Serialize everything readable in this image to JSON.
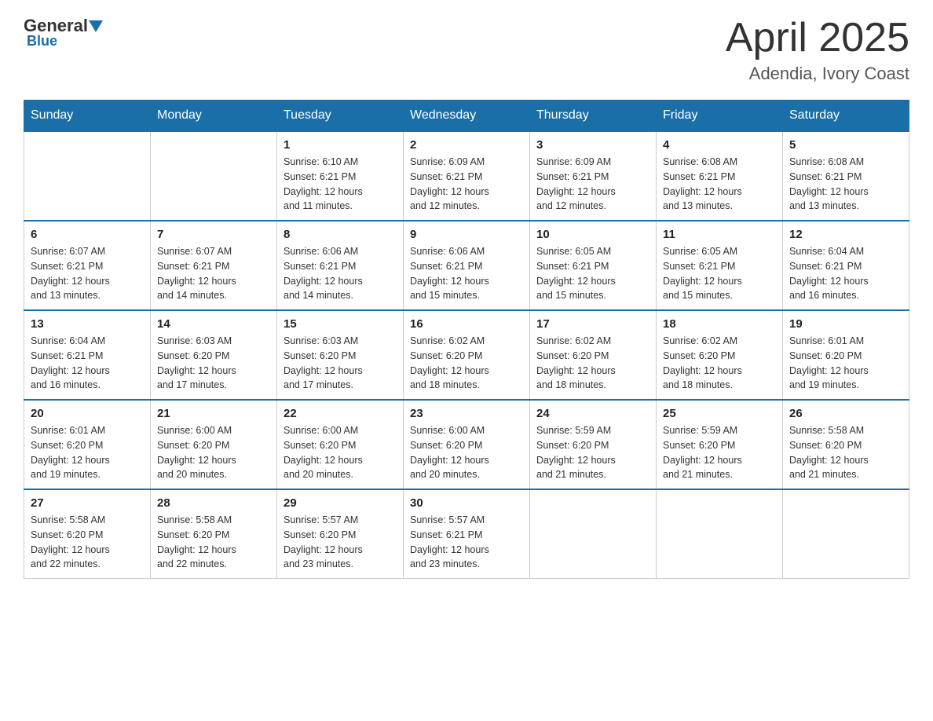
{
  "logo": {
    "general": "General",
    "triangle": "▶",
    "blue": "Blue"
  },
  "header": {
    "month": "April 2025",
    "location": "Adendia, Ivory Coast"
  },
  "weekdays": [
    "Sunday",
    "Monday",
    "Tuesday",
    "Wednesday",
    "Thursday",
    "Friday",
    "Saturday"
  ],
  "weeks": [
    [
      {
        "day": "",
        "info": ""
      },
      {
        "day": "",
        "info": ""
      },
      {
        "day": "1",
        "info": "Sunrise: 6:10 AM\nSunset: 6:21 PM\nDaylight: 12 hours\nand 11 minutes."
      },
      {
        "day": "2",
        "info": "Sunrise: 6:09 AM\nSunset: 6:21 PM\nDaylight: 12 hours\nand 12 minutes."
      },
      {
        "day": "3",
        "info": "Sunrise: 6:09 AM\nSunset: 6:21 PM\nDaylight: 12 hours\nand 12 minutes."
      },
      {
        "day": "4",
        "info": "Sunrise: 6:08 AM\nSunset: 6:21 PM\nDaylight: 12 hours\nand 13 minutes."
      },
      {
        "day": "5",
        "info": "Sunrise: 6:08 AM\nSunset: 6:21 PM\nDaylight: 12 hours\nand 13 minutes."
      }
    ],
    [
      {
        "day": "6",
        "info": "Sunrise: 6:07 AM\nSunset: 6:21 PM\nDaylight: 12 hours\nand 13 minutes."
      },
      {
        "day": "7",
        "info": "Sunrise: 6:07 AM\nSunset: 6:21 PM\nDaylight: 12 hours\nand 14 minutes."
      },
      {
        "day": "8",
        "info": "Sunrise: 6:06 AM\nSunset: 6:21 PM\nDaylight: 12 hours\nand 14 minutes."
      },
      {
        "day": "9",
        "info": "Sunrise: 6:06 AM\nSunset: 6:21 PM\nDaylight: 12 hours\nand 15 minutes."
      },
      {
        "day": "10",
        "info": "Sunrise: 6:05 AM\nSunset: 6:21 PM\nDaylight: 12 hours\nand 15 minutes."
      },
      {
        "day": "11",
        "info": "Sunrise: 6:05 AM\nSunset: 6:21 PM\nDaylight: 12 hours\nand 15 minutes."
      },
      {
        "day": "12",
        "info": "Sunrise: 6:04 AM\nSunset: 6:21 PM\nDaylight: 12 hours\nand 16 minutes."
      }
    ],
    [
      {
        "day": "13",
        "info": "Sunrise: 6:04 AM\nSunset: 6:21 PM\nDaylight: 12 hours\nand 16 minutes."
      },
      {
        "day": "14",
        "info": "Sunrise: 6:03 AM\nSunset: 6:20 PM\nDaylight: 12 hours\nand 17 minutes."
      },
      {
        "day": "15",
        "info": "Sunrise: 6:03 AM\nSunset: 6:20 PM\nDaylight: 12 hours\nand 17 minutes."
      },
      {
        "day": "16",
        "info": "Sunrise: 6:02 AM\nSunset: 6:20 PM\nDaylight: 12 hours\nand 18 minutes."
      },
      {
        "day": "17",
        "info": "Sunrise: 6:02 AM\nSunset: 6:20 PM\nDaylight: 12 hours\nand 18 minutes."
      },
      {
        "day": "18",
        "info": "Sunrise: 6:02 AM\nSunset: 6:20 PM\nDaylight: 12 hours\nand 18 minutes."
      },
      {
        "day": "19",
        "info": "Sunrise: 6:01 AM\nSunset: 6:20 PM\nDaylight: 12 hours\nand 19 minutes."
      }
    ],
    [
      {
        "day": "20",
        "info": "Sunrise: 6:01 AM\nSunset: 6:20 PM\nDaylight: 12 hours\nand 19 minutes."
      },
      {
        "day": "21",
        "info": "Sunrise: 6:00 AM\nSunset: 6:20 PM\nDaylight: 12 hours\nand 20 minutes."
      },
      {
        "day": "22",
        "info": "Sunrise: 6:00 AM\nSunset: 6:20 PM\nDaylight: 12 hours\nand 20 minutes."
      },
      {
        "day": "23",
        "info": "Sunrise: 6:00 AM\nSunset: 6:20 PM\nDaylight: 12 hours\nand 20 minutes."
      },
      {
        "day": "24",
        "info": "Sunrise: 5:59 AM\nSunset: 6:20 PM\nDaylight: 12 hours\nand 21 minutes."
      },
      {
        "day": "25",
        "info": "Sunrise: 5:59 AM\nSunset: 6:20 PM\nDaylight: 12 hours\nand 21 minutes."
      },
      {
        "day": "26",
        "info": "Sunrise: 5:58 AM\nSunset: 6:20 PM\nDaylight: 12 hours\nand 21 minutes."
      }
    ],
    [
      {
        "day": "27",
        "info": "Sunrise: 5:58 AM\nSunset: 6:20 PM\nDaylight: 12 hours\nand 22 minutes."
      },
      {
        "day": "28",
        "info": "Sunrise: 5:58 AM\nSunset: 6:20 PM\nDaylight: 12 hours\nand 22 minutes."
      },
      {
        "day": "29",
        "info": "Sunrise: 5:57 AM\nSunset: 6:20 PM\nDaylight: 12 hours\nand 23 minutes."
      },
      {
        "day": "30",
        "info": "Sunrise: 5:57 AM\nSunset: 6:21 PM\nDaylight: 12 hours\nand 23 minutes."
      },
      {
        "day": "",
        "info": ""
      },
      {
        "day": "",
        "info": ""
      },
      {
        "day": "",
        "info": ""
      }
    ]
  ]
}
